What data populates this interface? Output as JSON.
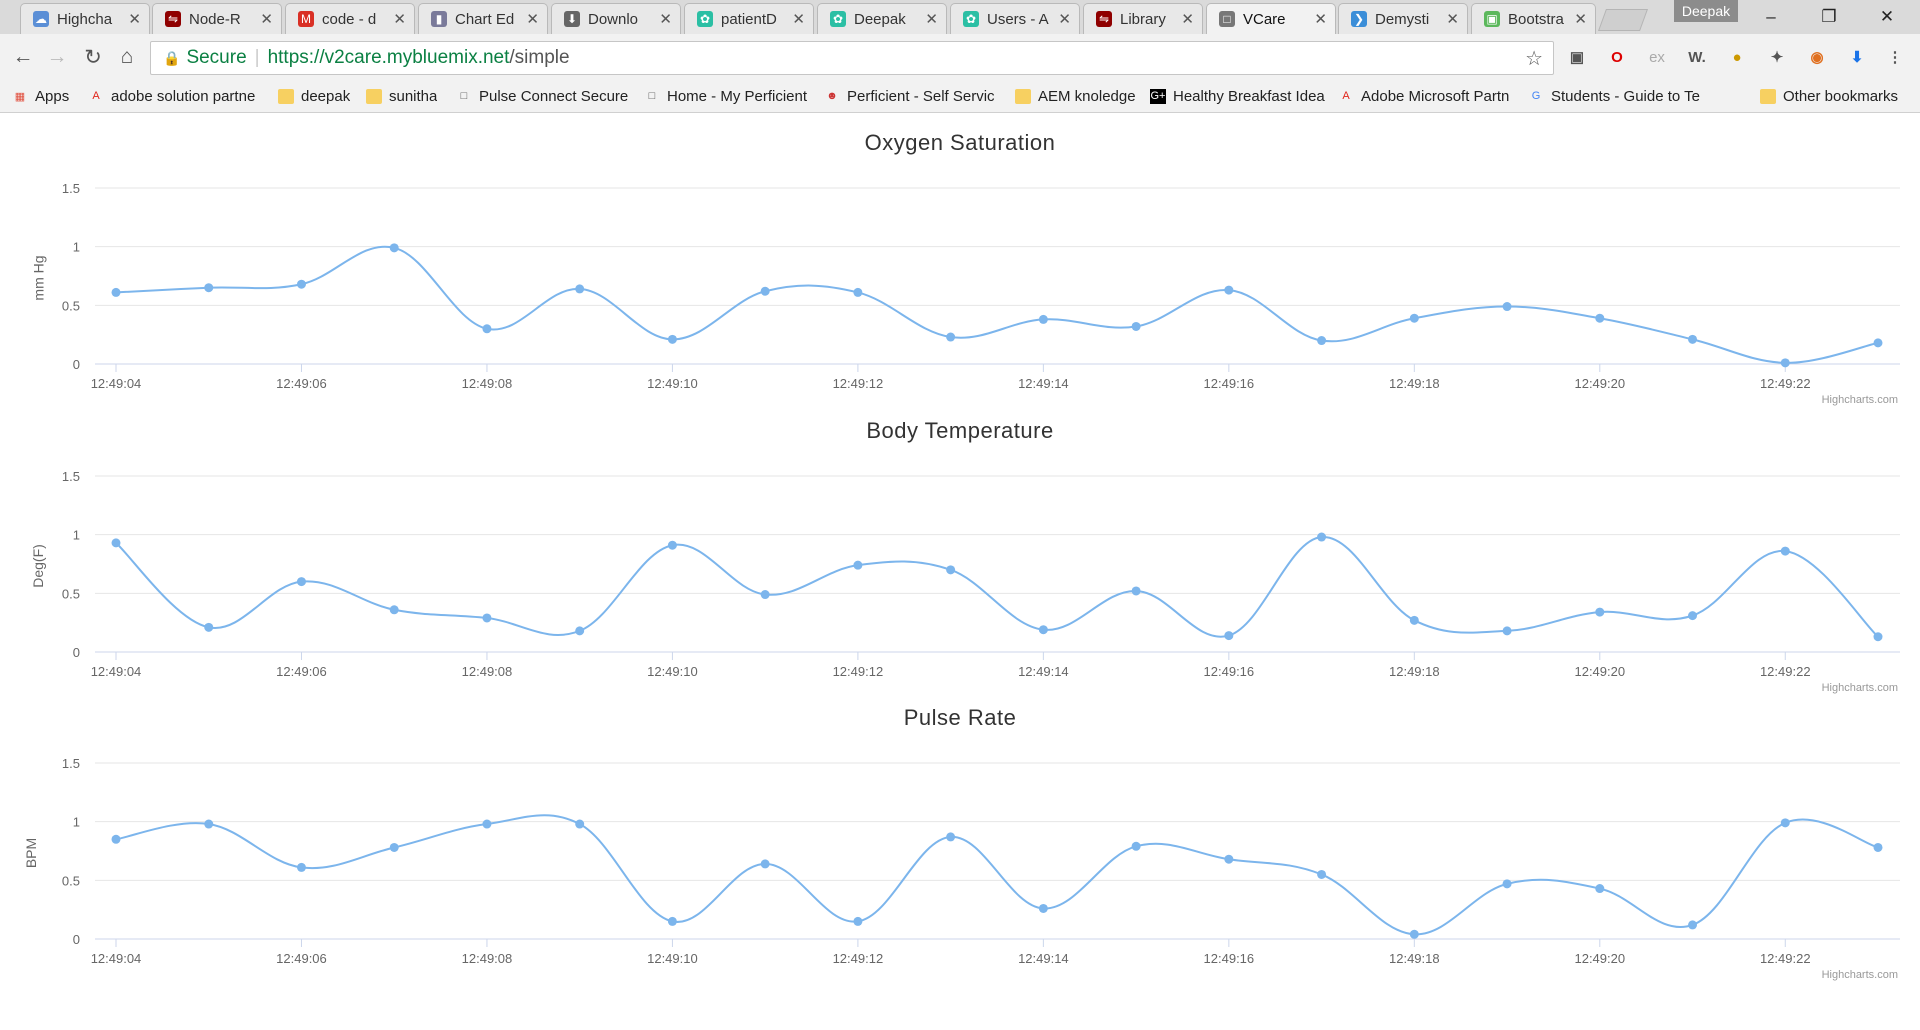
{
  "browser": {
    "tabs": [
      {
        "label": "Highcha",
        "icon": "cloud-icon",
        "color": "#5b8fd6"
      },
      {
        "label": "Node-R",
        "icon": "node-red-icon",
        "color": "#8f0000"
      },
      {
        "label": "code - d",
        "icon": "gmail-icon",
        "color": "#d93025"
      },
      {
        "label": "Chart Ed",
        "icon": "bar-chart-icon",
        "color": "#7a7a9a"
      },
      {
        "label": "Downlo",
        "icon": "download-icon",
        "color": "#666666"
      },
      {
        "label": "patientD",
        "icon": "bluemix-icon",
        "color": "#2bbfa4"
      },
      {
        "label": "Deepak",
        "icon": "bluemix-icon",
        "color": "#2bbfa4"
      },
      {
        "label": "Users - A",
        "icon": "bluemix-icon",
        "color": "#2bbfa4"
      },
      {
        "label": "Library",
        "icon": "node-red-icon",
        "color": "#8f0000"
      },
      {
        "label": "VCare",
        "icon": "page-icon",
        "color": "#777777",
        "active": true
      },
      {
        "label": "Demysti",
        "icon": "demystified-icon",
        "color": "#3b8ed8"
      },
      {
        "label": "Bootstra",
        "icon": "bootstrap-icon",
        "color": "#5cb85c"
      }
    ],
    "profile": "Deepak",
    "secure_label": "Secure",
    "url_host": "https://v2care.mybluemix.net",
    "url_path": "/simple",
    "bookmarks": [
      {
        "label": "Apps",
        "icon": "apps-grid-icon"
      },
      {
        "label": "adobe solution partne",
        "icon": "adobe-icon"
      },
      {
        "label": "deepak",
        "icon": "folder-icon"
      },
      {
        "label": "sunitha",
        "icon": "folder-icon"
      },
      {
        "label": "Pulse Connect Secure",
        "icon": "page-icon"
      },
      {
        "label": "Home - My Perficient",
        "icon": "page-icon"
      },
      {
        "label": "Perficient - Self Servic",
        "icon": "perficient-icon"
      },
      {
        "label": "AEM knoledge",
        "icon": "folder-icon"
      },
      {
        "label": "Healthy Breakfast Idea",
        "icon": "g-plus-icon"
      },
      {
        "label": "Adobe Microsoft Partn",
        "icon": "adobe-icon"
      },
      {
        "label": "Students - Guide to Te",
        "icon": "google-icon"
      },
      {
        "label": "Other bookmarks",
        "icon": "folder-icon"
      }
    ]
  },
  "page": {
    "credits": "Highcharts.com"
  },
  "chart_data": [
    {
      "type": "line",
      "title": "Oxygen Saturation",
      "ylabel": "mm Hg",
      "xlabel": "",
      "ylim": [
        0,
        1.5
      ],
      "yticks": [
        "0",
        "0.5",
        "1",
        "1.5"
      ],
      "xtick_labels": [
        "12:49:04",
        "12:49:06",
        "12:49:08",
        "12:49:10",
        "12:49:12",
        "12:49:14",
        "12:49:16",
        "12:49:18",
        "12:49:20",
        "12:49:22"
      ],
      "x": [
        "12:49:04",
        "12:49:05",
        "12:49:06",
        "12:49:07",
        "12:49:08",
        "12:49:09",
        "12:49:10",
        "12:49:11",
        "12:49:12",
        "12:49:13",
        "12:49:14",
        "12:49:15",
        "12:49:16",
        "12:49:17",
        "12:49:18",
        "12:49:19",
        "12:49:20",
        "12:49:21",
        "12:49:22",
        "12:49:23"
      ],
      "values": [
        0.61,
        0.65,
        0.68,
        0.99,
        0.3,
        0.64,
        0.21,
        0.62,
        0.61,
        0.23,
        0.38,
        0.32,
        0.63,
        0.2,
        0.39,
        0.49,
        0.39,
        0.21,
        0.01,
        0.18
      ],
      "color": "#7cb5ec",
      "grid": true
    },
    {
      "type": "line",
      "title": "Body Temperature",
      "ylabel": "Deg(F)",
      "xlabel": "",
      "ylim": [
        0,
        1.5
      ],
      "yticks": [
        "0",
        "0.5",
        "1",
        "1.5"
      ],
      "xtick_labels": [
        "12:49:04",
        "12:49:06",
        "12:49:08",
        "12:49:10",
        "12:49:12",
        "12:49:14",
        "12:49:16",
        "12:49:18",
        "12:49:20",
        "12:49:22"
      ],
      "x": [
        "12:49:04",
        "12:49:05",
        "12:49:06",
        "12:49:07",
        "12:49:08",
        "12:49:09",
        "12:49:10",
        "12:49:11",
        "12:49:12",
        "12:49:13",
        "12:49:14",
        "12:49:15",
        "12:49:16",
        "12:49:17",
        "12:49:18",
        "12:49:19",
        "12:49:20",
        "12:49:21",
        "12:49:22",
        "12:49:23"
      ],
      "values": [
        0.93,
        0.21,
        0.6,
        0.36,
        0.29,
        0.18,
        0.91,
        0.49,
        0.74,
        0.7,
        0.19,
        0.52,
        0.14,
        0.98,
        0.27,
        0.18,
        0.34,
        0.31,
        0.86,
        0.13
      ],
      "color": "#7cb5ec",
      "grid": true
    },
    {
      "type": "line",
      "title": "Pulse Rate",
      "ylabel": "BPM",
      "xlabel": "",
      "ylim": [
        0,
        1.5
      ],
      "yticks": [
        "0",
        "0.5",
        "1",
        "1.5"
      ],
      "xtick_labels": [
        "12:49:04",
        "12:49:06",
        "12:49:08",
        "12:49:10",
        "12:49:12",
        "12:49:14",
        "12:49:16",
        "12:49:18",
        "12:49:20",
        "12:49:22"
      ],
      "x": [
        "12:49:04",
        "12:49:05",
        "12:49:06",
        "12:49:07",
        "12:49:08",
        "12:49:09",
        "12:49:10",
        "12:49:11",
        "12:49:12",
        "12:49:13",
        "12:49:14",
        "12:49:15",
        "12:49:16",
        "12:49:17",
        "12:49:18",
        "12:49:19",
        "12:49:20",
        "12:49:21",
        "12:49:22",
        "12:49:23"
      ],
      "values": [
        0.85,
        0.98,
        0.61,
        0.78,
        0.98,
        0.98,
        0.15,
        0.64,
        0.15,
        0.87,
        0.26,
        0.79,
        0.68,
        0.55,
        0.04,
        0.47,
        0.43,
        0.12,
        0.99,
        0.78
      ],
      "color": "#7cb5ec",
      "grid": true
    }
  ]
}
